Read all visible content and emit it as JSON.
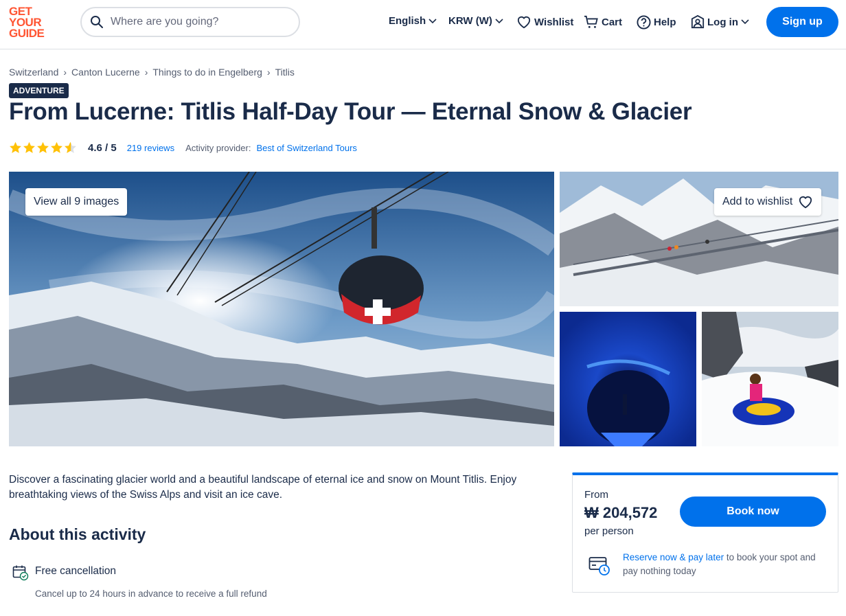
{
  "header": {
    "logo_lines": [
      "GET",
      "YOUR",
      "GUIDE"
    ],
    "search_placeholder": "Where are you going?",
    "language": "English",
    "currency": "KRW (W)",
    "wishlist": "Wishlist",
    "cart": "Cart",
    "help": "Help",
    "login": "Log in",
    "signup": "Sign up"
  },
  "breadcrumb": [
    "Switzerland",
    "Canton Lucerne",
    "Things to do in Engelberg",
    "Titlis"
  ],
  "badge": "ADVENTURE",
  "title": "From Lucerne: Titlis Half-Day Tour — Eternal Snow & Glacier",
  "rating": {
    "stars": 4.6,
    "value": "4.6 / 5",
    "reviews": "219 reviews",
    "provider_label": "Activity provider:",
    "provider": "Best of Switzerland Tours"
  },
  "gallery": {
    "view_all": "View all 9 images",
    "add_wishlist": "Add to wishlist"
  },
  "description": "Discover a fascinating glacier world and a beautiful landscape of eternal ice and snow on Mount Titlis. Enjoy breathtaking views of the Swiss Alps and visit an ice cave.",
  "about": {
    "heading": "About this activity",
    "features": [
      {
        "title": "Free cancellation",
        "subtitle": "Cancel up to 24 hours in advance to receive a full refund"
      }
    ]
  },
  "booking": {
    "from": "From",
    "price": "₩ 204,572",
    "per": "per person",
    "book_now": "Book now",
    "reserve_link": "Reserve now & pay later",
    "reserve_rest": " to book your spot and pay nothing today"
  },
  "colors": {
    "accent": "#0071eb",
    "brand": "#ff5533",
    "star": "#ffc107",
    "navy": "#1a2b49"
  }
}
